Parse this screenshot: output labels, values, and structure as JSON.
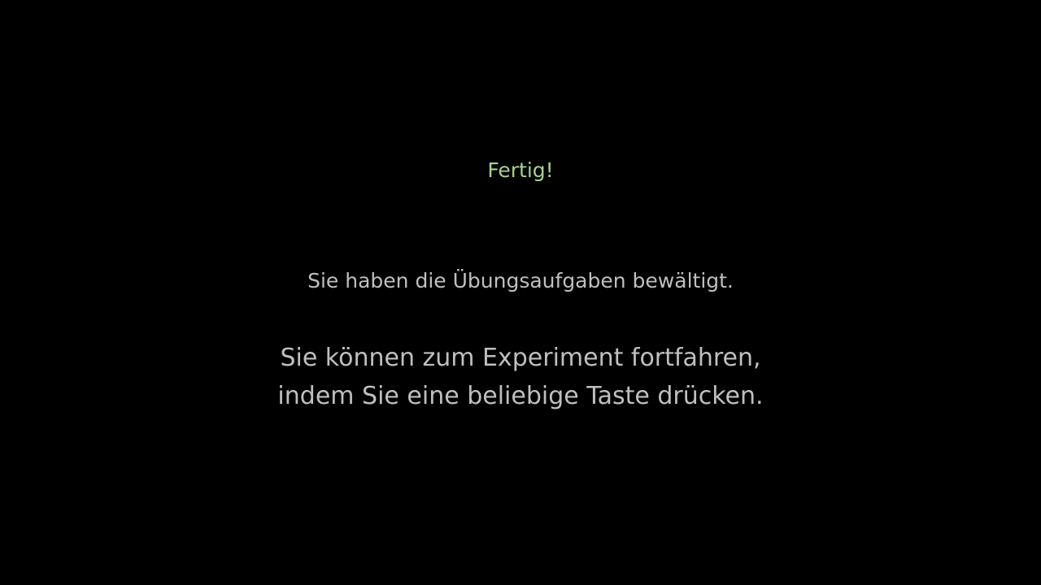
{
  "screen": {
    "title": "Fertig!",
    "subtitle": "Sie haben die Übungsaufgaben bewältigt.",
    "instruction_line1": "Sie können zum Experiment fortfahren,",
    "instruction_line2": "indem Sie eine beliebige Taste drücken."
  },
  "colors": {
    "background": "#000000",
    "title": "#a9d08e",
    "text": "#bfbfbf"
  }
}
